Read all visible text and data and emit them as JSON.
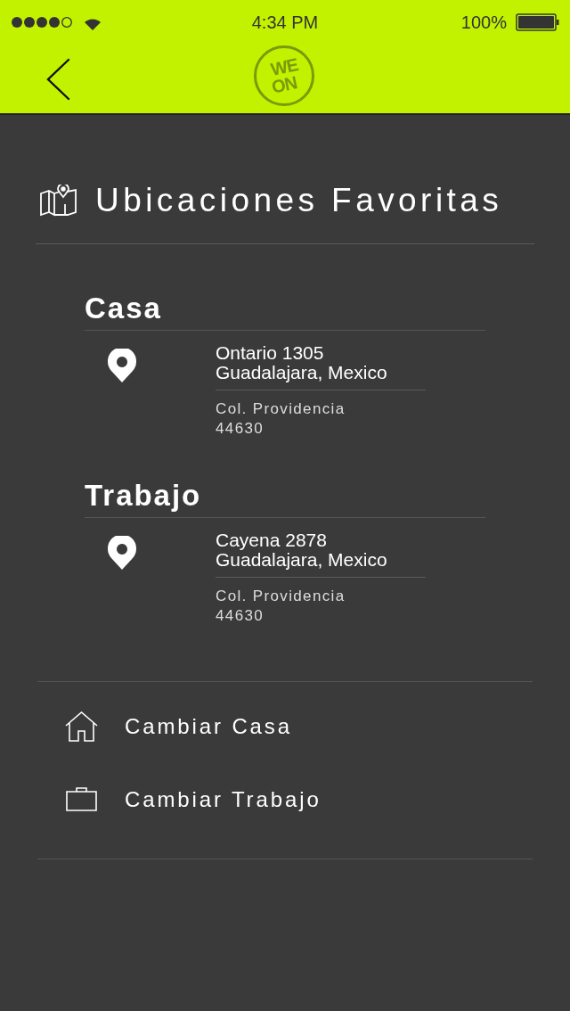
{
  "status_bar": {
    "time": "4:34 PM",
    "battery": "100%"
  },
  "header": {
    "logo_top": "WE",
    "logo_bottom": "ON"
  },
  "title": "Ubicaciones Favoritas",
  "locations": [
    {
      "name": "Casa",
      "street": "Ontario 1305",
      "city": "Guadalajara, Mexico",
      "neighborhood": "Col. Providencia",
      "zip": "44630"
    },
    {
      "name": "Trabajo",
      "street": "Cayena 2878",
      "city": "Guadalajara, Mexico",
      "neighborhood": "Col. Providencia",
      "zip": "44630"
    }
  ],
  "actions": [
    {
      "kind": "home",
      "label": "Cambiar Casa"
    },
    {
      "kind": "work",
      "label": "Cambiar Trabajo"
    }
  ]
}
